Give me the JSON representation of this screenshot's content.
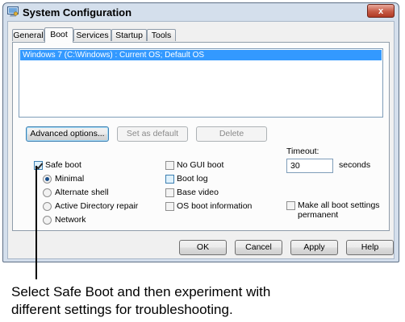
{
  "window": {
    "title": "System Configuration",
    "close_glyph": "x"
  },
  "tabs": [
    {
      "label": "General",
      "active": false
    },
    {
      "label": "Boot",
      "active": true
    },
    {
      "label": "Services",
      "active": false
    },
    {
      "label": "Startup",
      "active": false
    },
    {
      "label": "Tools",
      "active": false
    }
  ],
  "os_list": {
    "items": [
      "Windows 7 (C:\\Windows) : Current OS; Default OS"
    ],
    "selected_index": 0
  },
  "list_buttons": {
    "advanced": "Advanced options...",
    "set_default": "Set as default",
    "delete": "Delete"
  },
  "boot_options": {
    "safe_boot": {
      "label": "Safe boot",
      "checked": true
    },
    "radios": [
      {
        "label": "Minimal",
        "checked": true
      },
      {
        "label": "Alternate shell",
        "checked": false
      },
      {
        "label": "Active Directory repair",
        "checked": false
      },
      {
        "label": "Network",
        "checked": false
      }
    ],
    "checks": [
      {
        "label": "No GUI boot",
        "checked": false
      },
      {
        "label": "Boot log",
        "checked": false
      },
      {
        "label": "Base video",
        "checked": false
      },
      {
        "label": "OS boot information",
        "checked": false
      }
    ]
  },
  "timeout": {
    "label": "Timeout:",
    "value": "30",
    "unit": "seconds"
  },
  "permanent": {
    "line1": "Make all boot settings",
    "line2": "permanent",
    "checked": false
  },
  "dialog_buttons": {
    "ok": "OK",
    "cancel": "Cancel",
    "apply": "Apply",
    "help": "Help"
  },
  "caption": {
    "line1": "Select Safe Boot and then experiment with",
    "line2": "different settings for troubleshooting."
  },
  "colors": {
    "selection": "#3399ff",
    "window_frame": "#d4dfec",
    "close_button": "#c65a45"
  },
  "icons": {
    "app": "system-config-icon",
    "close": "close-icon"
  }
}
